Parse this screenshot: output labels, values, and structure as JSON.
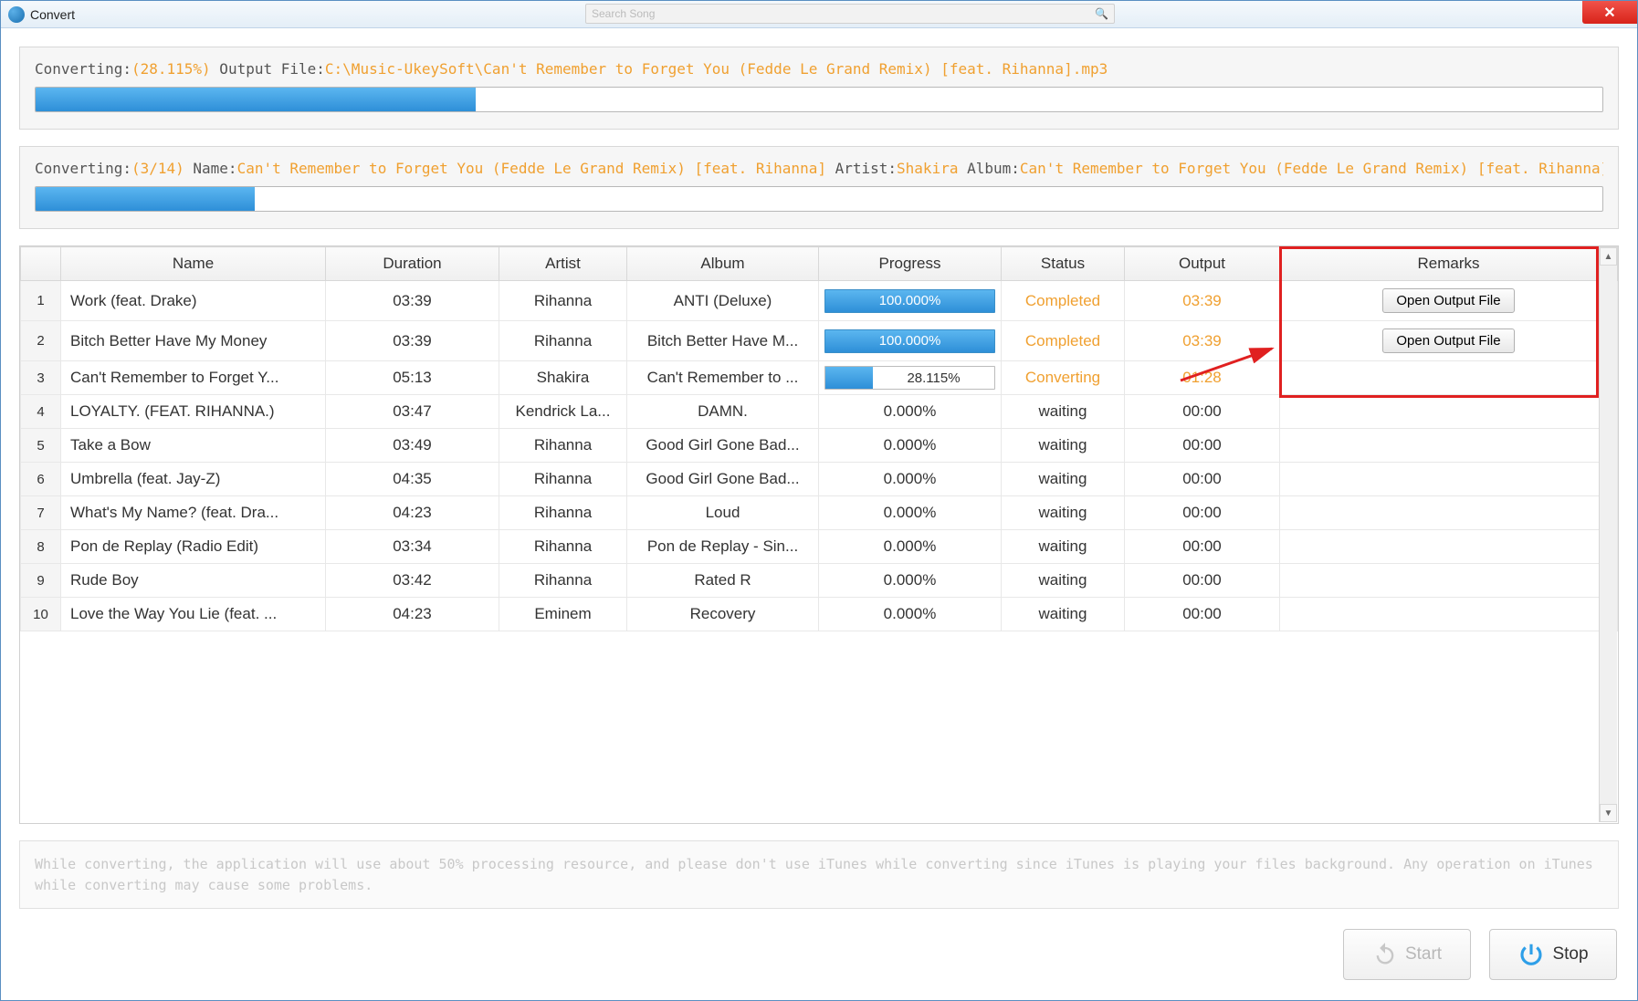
{
  "window": {
    "title": "Convert",
    "search_placeholder": "Search Song"
  },
  "overall": {
    "label_converting": "Converting:",
    "percent_text": "(28.115%)",
    "label_output": " Output File:",
    "output_path": "C:\\Music-UkeySoft\\Can't Remember to Forget You (Fedde Le Grand Remix) [feat. Rihanna].mp3",
    "progress_pct": 28.115
  },
  "current": {
    "label_converting": "Converting:",
    "count_text": "(3/14)",
    "label_name": " Name:",
    "name": "Can't Remember to Forget You (Fedde Le Grand Remix) [feat. Rihanna]",
    "label_artist": " Artist:",
    "artist": "Shakira",
    "label_album": " Album:",
    "album": "Can't Remember to Forget You (Fedde Le Grand Remix) [feat. Rihanna] - Single",
    "progress_pct": 14
  },
  "columns": [
    "",
    "Name",
    "Duration",
    "Artist",
    "Album",
    "Progress",
    "Status",
    "Output",
    "Remarks"
  ],
  "rows": [
    {
      "idx": "1",
      "name": "Work (feat. Drake)",
      "duration": "03:39",
      "artist": "Rihanna",
      "album": "ANTI (Deluxe)",
      "progress": "100.000%",
      "progress_pct": 100,
      "status": "Completed",
      "status_orange": true,
      "output": "03:39",
      "output_orange": true,
      "remarks_btn": "Open Output File"
    },
    {
      "idx": "2",
      "name": "Bitch Better Have My Money",
      "duration": "03:39",
      "artist": "Rihanna",
      "album": "Bitch Better Have M...",
      "progress": "100.000%",
      "progress_pct": 100,
      "status": "Completed",
      "status_orange": true,
      "output": "03:39",
      "output_orange": true,
      "remarks_btn": "Open Output File"
    },
    {
      "idx": "3",
      "name": "Can't Remember to Forget Y...",
      "duration": "05:13",
      "artist": "Shakira",
      "album": "Can't Remember to ...",
      "progress": "28.115%",
      "progress_pct": 28.115,
      "status": "Converting",
      "status_orange": true,
      "output": "01:28",
      "output_orange": true,
      "remarks_btn": ""
    },
    {
      "idx": "4",
      "name": "LOYALTY. (FEAT. RIHANNA.)",
      "duration": "03:47",
      "artist": "Kendrick La...",
      "album": "DAMN.",
      "progress": "0.000%",
      "progress_pct": 0,
      "status": "waiting",
      "status_orange": false,
      "output": "00:00",
      "output_orange": false,
      "remarks_btn": ""
    },
    {
      "idx": "5",
      "name": "Take a Bow",
      "duration": "03:49",
      "artist": "Rihanna",
      "album": "Good Girl Gone Bad...",
      "progress": "0.000%",
      "progress_pct": 0,
      "status": "waiting",
      "status_orange": false,
      "output": "00:00",
      "output_orange": false,
      "remarks_btn": ""
    },
    {
      "idx": "6",
      "name": "Umbrella (feat. Jay-Z)",
      "duration": "04:35",
      "artist": "Rihanna",
      "album": "Good Girl Gone Bad...",
      "progress": "0.000%",
      "progress_pct": 0,
      "status": "waiting",
      "status_orange": false,
      "output": "00:00",
      "output_orange": false,
      "remarks_btn": ""
    },
    {
      "idx": "7",
      "name": "What's My Name? (feat. Dra...",
      "duration": "04:23",
      "artist": "Rihanna",
      "album": "Loud",
      "progress": "0.000%",
      "progress_pct": 0,
      "status": "waiting",
      "status_orange": false,
      "output": "00:00",
      "output_orange": false,
      "remarks_btn": ""
    },
    {
      "idx": "8",
      "name": "Pon de Replay (Radio Edit)",
      "duration": "03:34",
      "artist": "Rihanna",
      "album": "Pon de Replay - Sin...",
      "progress": "0.000%",
      "progress_pct": 0,
      "status": "waiting",
      "status_orange": false,
      "output": "00:00",
      "output_orange": false,
      "remarks_btn": ""
    },
    {
      "idx": "9",
      "name": "Rude Boy",
      "duration": "03:42",
      "artist": "Rihanna",
      "album": "Rated R",
      "progress": "0.000%",
      "progress_pct": 0,
      "status": "waiting",
      "status_orange": false,
      "output": "00:00",
      "output_orange": false,
      "remarks_btn": ""
    },
    {
      "idx": "10",
      "name": "Love the Way You Lie (feat. ...",
      "duration": "04:23",
      "artist": "Eminem",
      "album": "Recovery",
      "progress": "0.000%",
      "progress_pct": 0,
      "status": "waiting",
      "status_orange": false,
      "output": "00:00",
      "output_orange": false,
      "remarks_btn": ""
    }
  ],
  "note": "While converting, the application will use about 50% processing resource, and please don't use iTunes while converting since iTunes is playing your files background. Any operation on iTunes while converting may cause some problems.",
  "buttons": {
    "start": "Start",
    "stop": "Stop"
  },
  "open_output_label": "Open Output File"
}
